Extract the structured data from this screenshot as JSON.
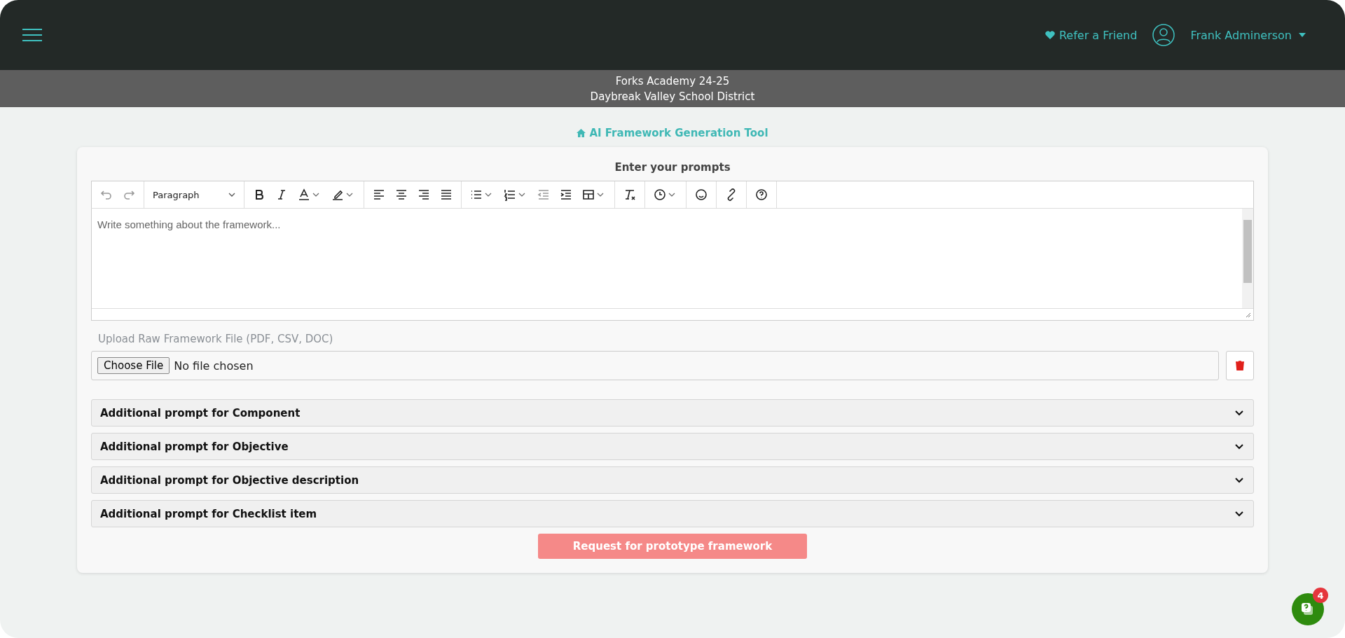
{
  "header": {
    "refer_link": "Refer a Friend",
    "user_name": "Frank Adminerson"
  },
  "context_bar": {
    "school": "Forks Academy 24-25",
    "district": "Daybreak Valley School District"
  },
  "page_title": "AI Framework Generation Tool",
  "editor": {
    "heading": "Enter your prompts",
    "block_format": "Paragraph",
    "placeholder": "Write something about the framework..."
  },
  "upload": {
    "label": "Upload Raw Framework File (PDF, CSV, DOC)",
    "choose_button": "Choose File",
    "status": "No file chosen"
  },
  "accordions": [
    {
      "title": "Additional prompt for Component",
      "expanded": false
    },
    {
      "title": "Additional prompt for Objective",
      "expanded": false
    },
    {
      "title": "Additional prompt for Objective description",
      "expanded": false
    },
    {
      "title": "Additional prompt for Checklist item",
      "expanded": false
    }
  ],
  "submit_button": {
    "label": "Request for prototype framework",
    "disabled": true
  },
  "chat_widget": {
    "badge": "4"
  }
}
